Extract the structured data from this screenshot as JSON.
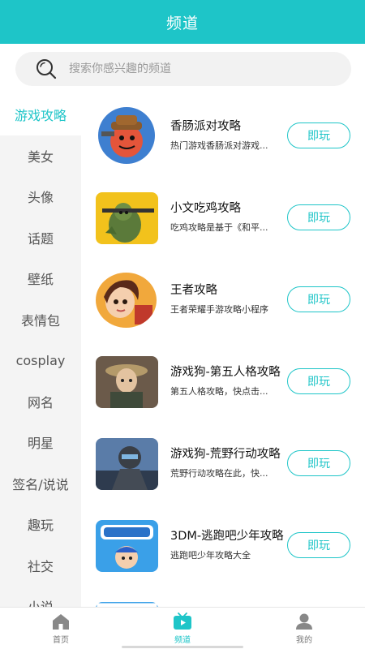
{
  "header": {
    "title": "频道"
  },
  "search": {
    "placeholder": "搜索你感兴趣的频道"
  },
  "sidebar": {
    "items": [
      {
        "label": "游戏攻略",
        "active": true
      },
      {
        "label": "美女"
      },
      {
        "label": "头像"
      },
      {
        "label": "话题"
      },
      {
        "label": "壁纸"
      },
      {
        "label": "表情包"
      },
      {
        "label": "cosplay"
      },
      {
        "label": "网名"
      },
      {
        "label": "明星"
      },
      {
        "label": "签名/说说"
      },
      {
        "label": "趣玩"
      },
      {
        "label": "社交"
      },
      {
        "label": "小说"
      }
    ]
  },
  "list": {
    "items": [
      {
        "title": "香肠派对攻略",
        "desc": "热门游戏香肠派对游戏...",
        "button": "即玩",
        "thumb_icon": "sausage-party-thumbnail"
      },
      {
        "title": "小文吃鸡攻略",
        "desc": "吃鸡攻略是基于《和平...",
        "button": "即玩",
        "thumb_icon": "pubg-soldier-thumbnail"
      },
      {
        "title": "王者攻略",
        "desc": "王者荣耀手游攻略小程序",
        "button": "即玩",
        "thumb_icon": "honor-of-kings-thumbnail"
      },
      {
        "title": "游戏狗-第五人格攻略",
        "desc": "第五人格攻略，快点击...",
        "button": "即玩",
        "thumb_icon": "identity-v-thumbnail"
      },
      {
        "title": "游戏狗-荒野行动攻略",
        "desc": "荒野行动攻略在此，快...",
        "button": "即玩",
        "thumb_icon": "knives-out-thumbnail"
      },
      {
        "title": "3DM-逃跑吧少年攻略",
        "desc": "逃跑吧少年攻略大全",
        "button": "即玩",
        "thumb_icon": "escape-boy-thumbnail"
      }
    ]
  },
  "tabbar": {
    "tabs": [
      {
        "label": "首页",
        "icon": "home-icon"
      },
      {
        "label": "频道",
        "icon": "tv-icon",
        "active": true
      },
      {
        "label": "我的",
        "icon": "person-icon"
      }
    ]
  },
  "colors": {
    "accent": "#1ec5c8",
    "sidebar_bg": "#f4f4f4",
    "text": "#111111"
  }
}
